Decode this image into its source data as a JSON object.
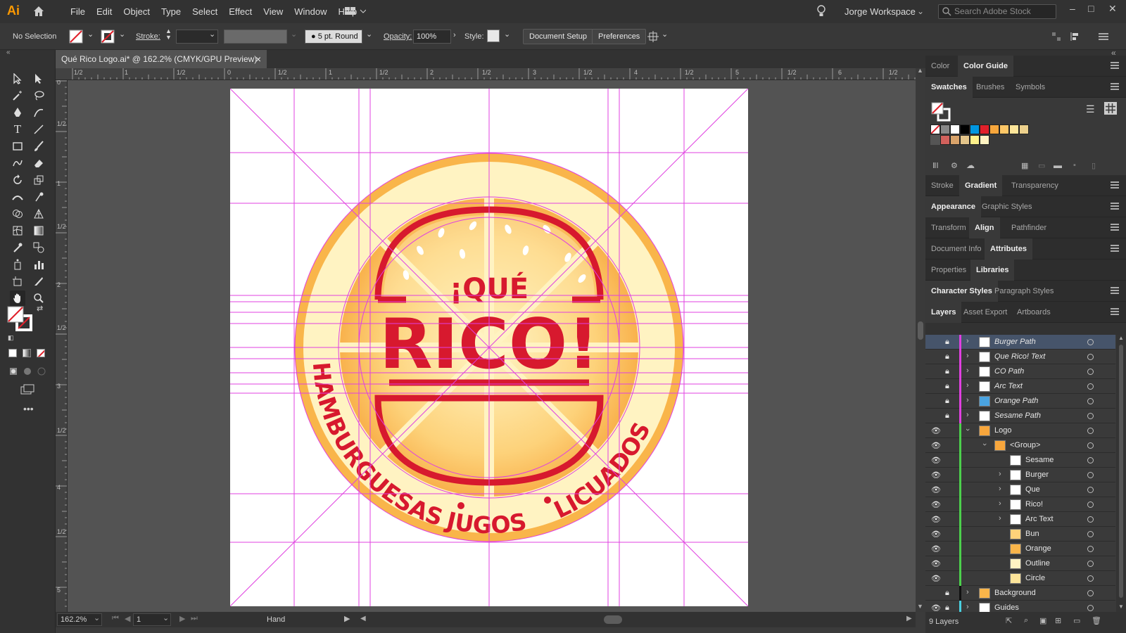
{
  "app": {
    "logo": "Ai"
  },
  "menu": [
    "File",
    "Edit",
    "Object",
    "Type",
    "Select",
    "Effect",
    "View",
    "Window",
    "Help"
  ],
  "workspace": "Jorge Workspace",
  "stock_placeholder": "Search Adobe Stock",
  "control": {
    "selection": "No Selection",
    "stroke_label": "Stroke:",
    "brush": "5 pt. Round",
    "opacity_label": "Opacity:",
    "opacity": "100%",
    "style_label": "Style:",
    "doc_setup": "Document Setup",
    "preferences": "Preferences"
  },
  "doc_tab": {
    "title": "Qué Rico Logo.ai* @ 162.2% (CMYK/GPU Preview)",
    "close": "×"
  },
  "ruler_top": [
    "1/2",
    "1",
    "1/2",
    "0",
    "1/2",
    "1",
    "1/2",
    "2",
    "1/2",
    "3",
    "1/2",
    "4",
    "1/2",
    "5",
    "1/2",
    "6",
    "1/2"
  ],
  "ruler_left": [
    "0",
    "1/2",
    "1",
    "1/2",
    "2",
    "1/2",
    "3",
    "1/2",
    "4",
    "1/2",
    "5"
  ],
  "artwork": {
    "que": "¡QUÉ",
    "rico": "RICO!",
    "arc_left": "HAMBURGUESAS",
    "arc_mid": "JUGOS",
    "arc_right": "LICUADOS",
    "colors": {
      "red": "#d7192e",
      "orange": "#f9a63a",
      "cream": "#fff0b5",
      "guide": "#e040e0"
    }
  },
  "status": {
    "zoom": "162.2%",
    "page": "1",
    "tool": "Hand"
  },
  "panels": {
    "row1": [
      "Color",
      "Color Guide"
    ],
    "row2": [
      "Swatches",
      "Brushes",
      "Symbols"
    ],
    "row3": [
      "Stroke",
      "Gradient",
      "Transparency"
    ],
    "row4": [
      "Appearance",
      "Graphic Styles"
    ],
    "row5": [
      "Transform",
      "Align",
      "Pathfinder"
    ],
    "row6": [
      "Document Info",
      "Attributes"
    ],
    "row7": [
      "Properties",
      "Libraries"
    ],
    "row8": [
      "Character Styles",
      "Paragraph Styles"
    ],
    "row9": [
      "Layers",
      "Asset Export",
      "Artboards"
    ]
  },
  "layers": [
    {
      "name": "Burger Path",
      "italic": true
    },
    {
      "name": "Que Rico! Text",
      "italic": true
    },
    {
      "name": "CO Path",
      "italic": true
    },
    {
      "name": "Arc Text",
      "italic": true
    },
    {
      "name": "Orange Path",
      "italic": true
    },
    {
      "name": "Sesame Path",
      "italic": true
    },
    {
      "name": "Logo",
      "italic": false
    },
    {
      "name": "<Group>",
      "italic": false
    },
    {
      "name": "Sesame",
      "italic": false
    },
    {
      "name": "Burger",
      "italic": false
    },
    {
      "name": "Que",
      "italic": false
    },
    {
      "name": "Rico!",
      "italic": false
    },
    {
      "name": "Arc Text",
      "italic": false
    },
    {
      "name": "Bun",
      "italic": false
    },
    {
      "name": "Orange",
      "italic": false
    },
    {
      "name": "Outline",
      "italic": false
    },
    {
      "name": "Circle",
      "italic": false
    },
    {
      "name": "Background",
      "italic": false
    },
    {
      "name": "Guides",
      "italic": false
    }
  ],
  "layers_count": "9 Layers"
}
